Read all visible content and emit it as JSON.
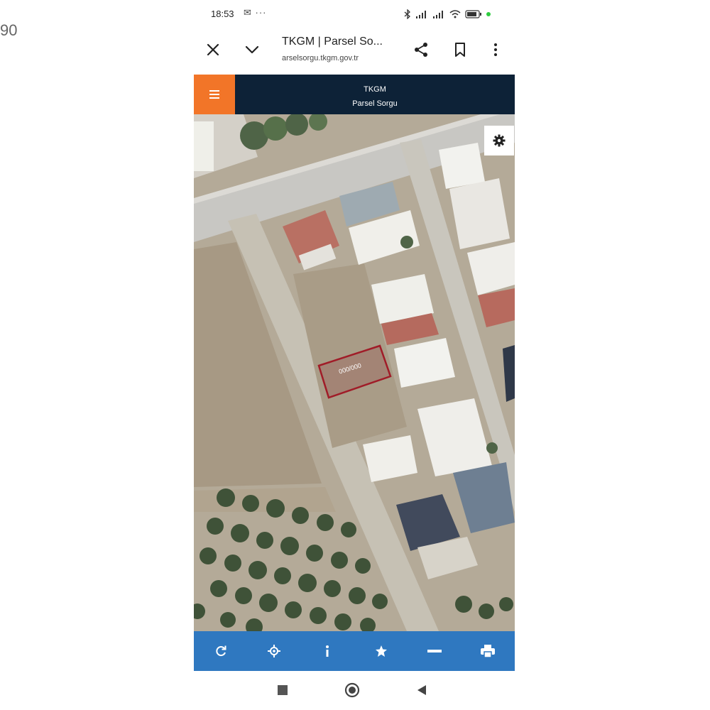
{
  "edge_text": "90",
  "status_bar": {
    "time": "18:53",
    "extra_icons": "✉ ···",
    "icons": [
      "bluetooth-icon",
      "signal-icon",
      "signal-icon",
      "wifi-icon",
      "battery-icon"
    ],
    "dot_color": "#2ecc40"
  },
  "browser": {
    "title": "TKGM | Parsel So...",
    "url": "arselsorgu.tkgm.gov.tr",
    "icons": [
      "close-icon",
      "chevron-down-icon",
      "share-icon",
      "bookmark-icon",
      "more-vert-icon"
    ]
  },
  "app_header": {
    "title": "TKGM",
    "subtitle": "Parsel Sorgu",
    "menu_icon": "hamburger-menu-icon",
    "menu_color": "#f27528",
    "bar_color": "#0d2237"
  },
  "map": {
    "parcel_label": "000/000",
    "parcel_outline_color": "#a01c28",
    "settings_icon": "gear-icon"
  },
  "toolbar": {
    "color": "#2f78c0",
    "icons": [
      "refresh-icon",
      "locate-icon",
      "info-icon",
      "star-icon",
      "minus-icon",
      "print-icon"
    ]
  },
  "nav_bar": {
    "icons": [
      "recent-apps-icon",
      "home-icon",
      "back-icon"
    ]
  }
}
